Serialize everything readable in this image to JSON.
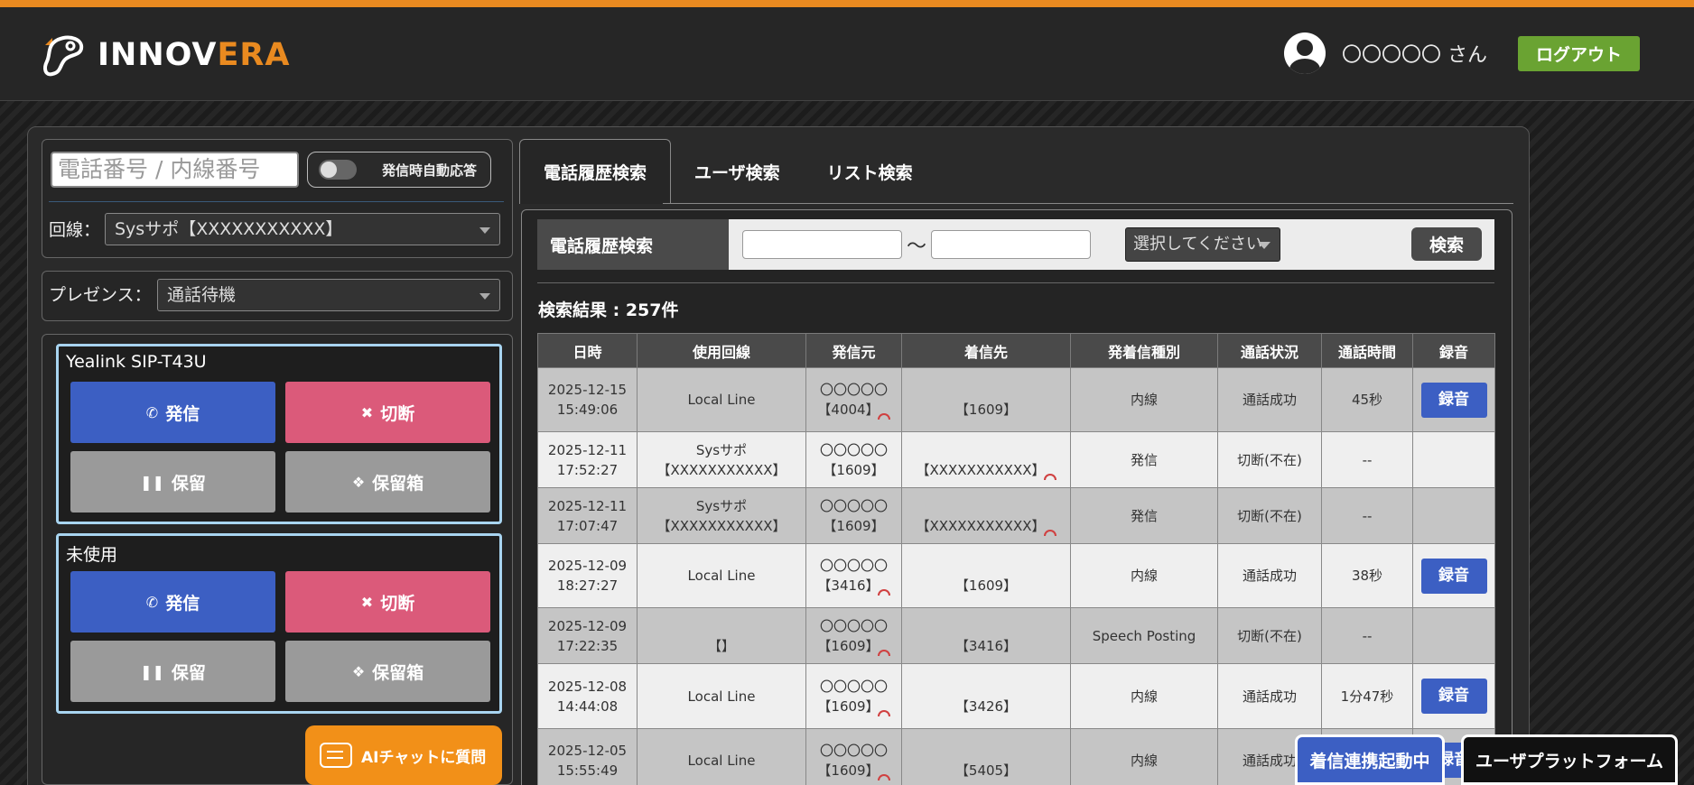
{
  "header": {
    "logo_text_a": "INNOV",
    "logo_text_b": "ERA",
    "username": "〇〇〇〇〇 さん",
    "logout_label": "ログアウト",
    "accent_color": "#e98a20"
  },
  "dialer": {
    "number_placeholder": "電話番号 / 内線番号",
    "auto_answer_label": "発信時自動応答",
    "line_label": "回線：",
    "line_selected": "Sysサポ【XXXXXXXXXXX】",
    "presence_label": "プレゼンス：",
    "presence_selected": "通話待機"
  },
  "phones": [
    {
      "title": "Yealink SIP-T43U",
      "call_label": "発信",
      "cut_label": "切断",
      "hold_label": "保留",
      "holdbox_label": "保留箱"
    },
    {
      "title": "未使用",
      "call_label": "発信",
      "cut_label": "切断",
      "hold_label": "保留",
      "holdbox_label": "保留箱"
    }
  ],
  "ai_chat_label": "AIチャットに質問",
  "tabs": [
    "電話履歴検索",
    "ユーザ検索",
    "リスト検索"
  ],
  "search": {
    "title": "電話履歴検索",
    "tilde": "〜",
    "type_placeholder": "選択してください",
    "button_label": "検索",
    "result_count": "検索結果 : 257件"
  },
  "table": {
    "headers": [
      "日時",
      "使用回線",
      "発信元",
      "着信先",
      "発着信種別",
      "通話状況",
      "通話時間",
      "録音"
    ],
    "rows": [
      {
        "date": "2025-12-15",
        "time": "15:49:06",
        "line1": "Local Line",
        "line2": "",
        "from1": "〇〇〇〇〇",
        "from2": "【4004】",
        "to": "【1609】",
        "type": "内線",
        "status": "通話成功",
        "duration": "45秒",
        "rec": "録音"
      },
      {
        "date": "2025-12-11",
        "time": "17:52:27",
        "line1": "Sysサポ",
        "line2": "【XXXXXXXXXXX】",
        "from1": "〇〇〇〇〇",
        "from2": "【1609】",
        "to": "【XXXXXXXXXXX】",
        "type": "発信",
        "status": "切断(不在)",
        "duration": "--",
        "rec": ""
      },
      {
        "date": "2025-12-11",
        "time": "17:07:47",
        "line1": "Sysサポ",
        "line2": "【XXXXXXXXXXX】",
        "from1": "〇〇〇〇〇",
        "from2": "【1609】",
        "to": "【XXXXXXXXXXX】",
        "type": "発信",
        "status": "切断(不在)",
        "duration": "--",
        "rec": ""
      },
      {
        "date": "2025-12-09",
        "time": "18:27:27",
        "line1": "Local Line",
        "line2": "",
        "from1": "〇〇〇〇〇",
        "from2": "【3416】",
        "to": "【1609】",
        "type": "内線",
        "status": "通話成功",
        "duration": "38秒",
        "rec": "録音"
      },
      {
        "date": "2025-12-09",
        "time": "17:22:35",
        "line1": "【】",
        "line2": "",
        "from1": "〇〇〇〇〇",
        "from2": "【1609】",
        "to": "【3416】",
        "type": "Speech Posting",
        "status": "切断(不在)",
        "duration": "--",
        "rec": ""
      },
      {
        "date": "2025-12-08",
        "time": "14:44:08",
        "line1": "Local Line",
        "line2": "",
        "from1": "〇〇〇〇〇",
        "from2": "【1609】",
        "to": "【3426】",
        "type": "内線",
        "status": "通話成功",
        "duration": "1分47秒",
        "rec": "録音"
      },
      {
        "date": "2025-12-05",
        "time": "15:55:49",
        "line1": "Local Line",
        "line2": "",
        "from1": "〇〇〇〇〇",
        "from2": "【1609】",
        "to": "【5405】",
        "type": "内線",
        "status": "通話成功",
        "duration": "",
        "rec": "録音"
      }
    ]
  },
  "footer": {
    "incoming_label": "着信連携起動中",
    "platform_label": "ユーザプラットフォーム"
  }
}
